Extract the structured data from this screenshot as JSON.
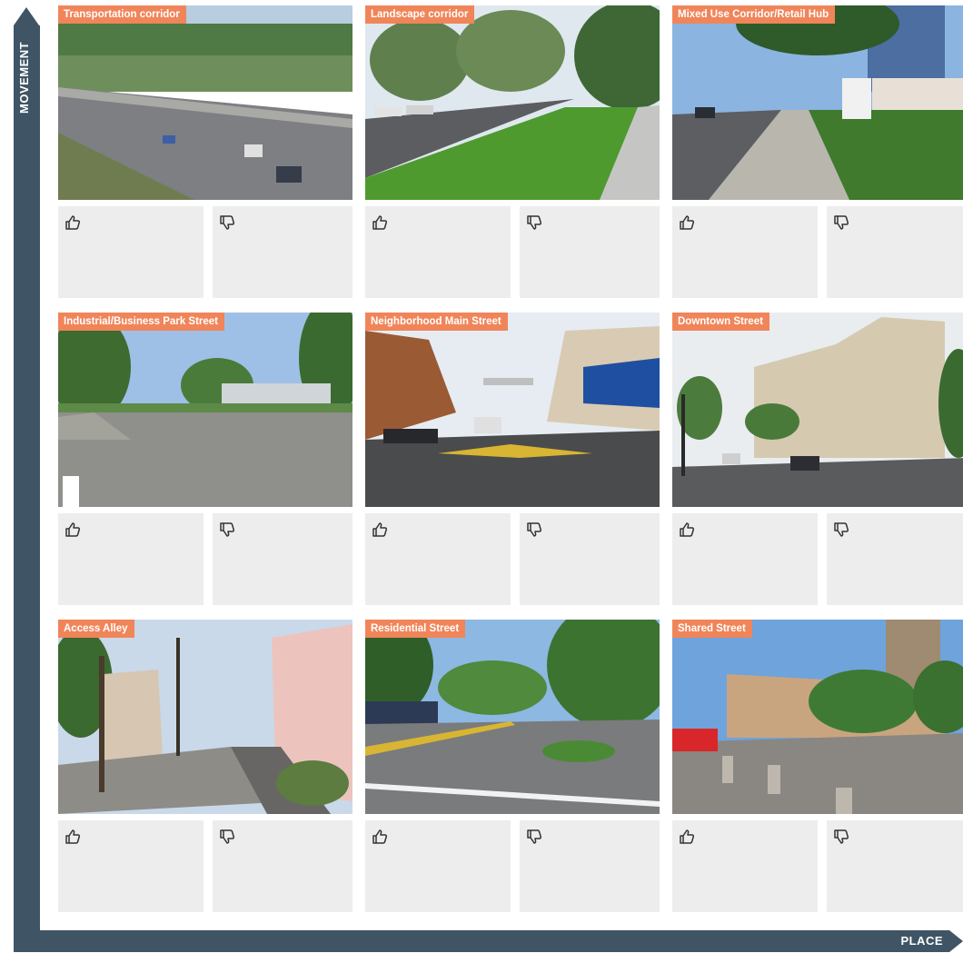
{
  "axis": {
    "vertical_label": "MOVEMENT",
    "horizontal_label": "PLACE"
  },
  "cards": [
    {
      "label": "Transportation corridor"
    },
    {
      "label": "Landscape corridor"
    },
    {
      "label": "Mixed Use Corridor/Retail Hub"
    },
    {
      "label": "Industrial/Business Park Street"
    },
    {
      "label": "Neighborhood Main Street"
    },
    {
      "label": "Downtown Street"
    },
    {
      "label": "Access Alley"
    },
    {
      "label": "Residential Street"
    },
    {
      "label": "Shared Street"
    }
  ],
  "icons": {
    "up": "thumbs-up-icon",
    "down": "thumbs-down-icon"
  },
  "colors": {
    "axis": "#3f5566",
    "tag": "#f0855a",
    "vote_bg": "#ededed"
  }
}
